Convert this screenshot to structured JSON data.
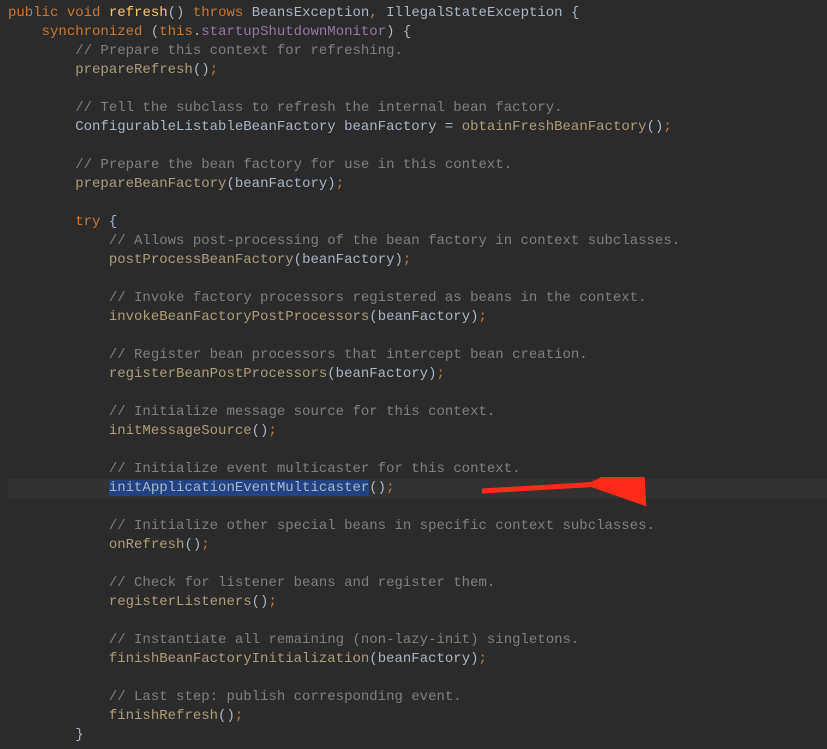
{
  "code": {
    "l1": {
      "kw1": "public",
      "kw2": "void",
      "name": "refresh",
      "paren": "()",
      "kw3": "throws",
      "ex1": "BeansException",
      "comma": ",",
      "ex2": "IllegalStateException",
      "brace": "{"
    },
    "l2": {
      "kw": "synchronized",
      "paren_o": "(",
      "this": "this",
      "dot": ".",
      "field": "startupShutdownMonitor",
      "paren_c": ")",
      "brace": "{"
    },
    "l3": "// Prepare this context for refreshing.",
    "l4": {
      "name": "prepareRefresh",
      "paren": "()",
      "semi": ";"
    },
    "l5": "// Tell the subclass to refresh the internal bean factory.",
    "l6": {
      "type": "ConfigurableListableBeanFactory",
      "var": "beanFactory",
      "eq": "=",
      "call": "obtainFreshBeanFactory",
      "paren": "()",
      "semi": ";"
    },
    "l7": "// Prepare the bean factory for use in this context.",
    "l8": {
      "name": "prepareBeanFactory",
      "paren_o": "(",
      "arg": "beanFactory",
      "paren_c": ")",
      "semi": ";"
    },
    "l9": {
      "kw": "try",
      "brace": "{"
    },
    "l10": "// Allows post-processing of the bean factory in context subclasses.",
    "l11": {
      "name": "postProcessBeanFactory",
      "paren_o": "(",
      "arg": "beanFactory",
      "paren_c": ")",
      "semi": ";"
    },
    "l12": "// Invoke factory processors registered as beans in the context.",
    "l13": {
      "name": "invokeBeanFactoryPostProcessors",
      "paren_o": "(",
      "arg": "beanFactory",
      "paren_c": ")",
      "semi": ";"
    },
    "l14": "// Register bean processors that intercept bean creation.",
    "l15": {
      "name": "registerBeanPostProcessors",
      "paren_o": "(",
      "arg": "beanFactory",
      "paren_c": ")",
      "semi": ";"
    },
    "l16": "// Initialize message source for this context.",
    "l17": {
      "name": "initMessageSource",
      "paren": "()",
      "semi": ";"
    },
    "l18": "// Initialize event multicaster for this context.",
    "l19": {
      "name": "initApplicationEventMulticaster",
      "paren": "()",
      "semi": ";"
    },
    "l20": "// Initialize other special beans in specific context subclasses.",
    "l21": {
      "name": "onRefresh",
      "paren": "()",
      "semi": ";"
    },
    "l22": "// Check for listener beans and register them.",
    "l23": {
      "name": "registerListeners",
      "paren": "()",
      "semi": ";"
    },
    "l24": "// Instantiate all remaining (non-lazy-init) singletons.",
    "l25": {
      "name": "finishBeanFactoryInitialization",
      "paren_o": "(",
      "arg": "beanFactory",
      "paren_c": ")",
      "semi": ";"
    },
    "l26": "// Last step: publish corresponding event.",
    "l27": {
      "name": "finishRefresh",
      "paren": "()",
      "semi": ";"
    },
    "l28": "}"
  }
}
